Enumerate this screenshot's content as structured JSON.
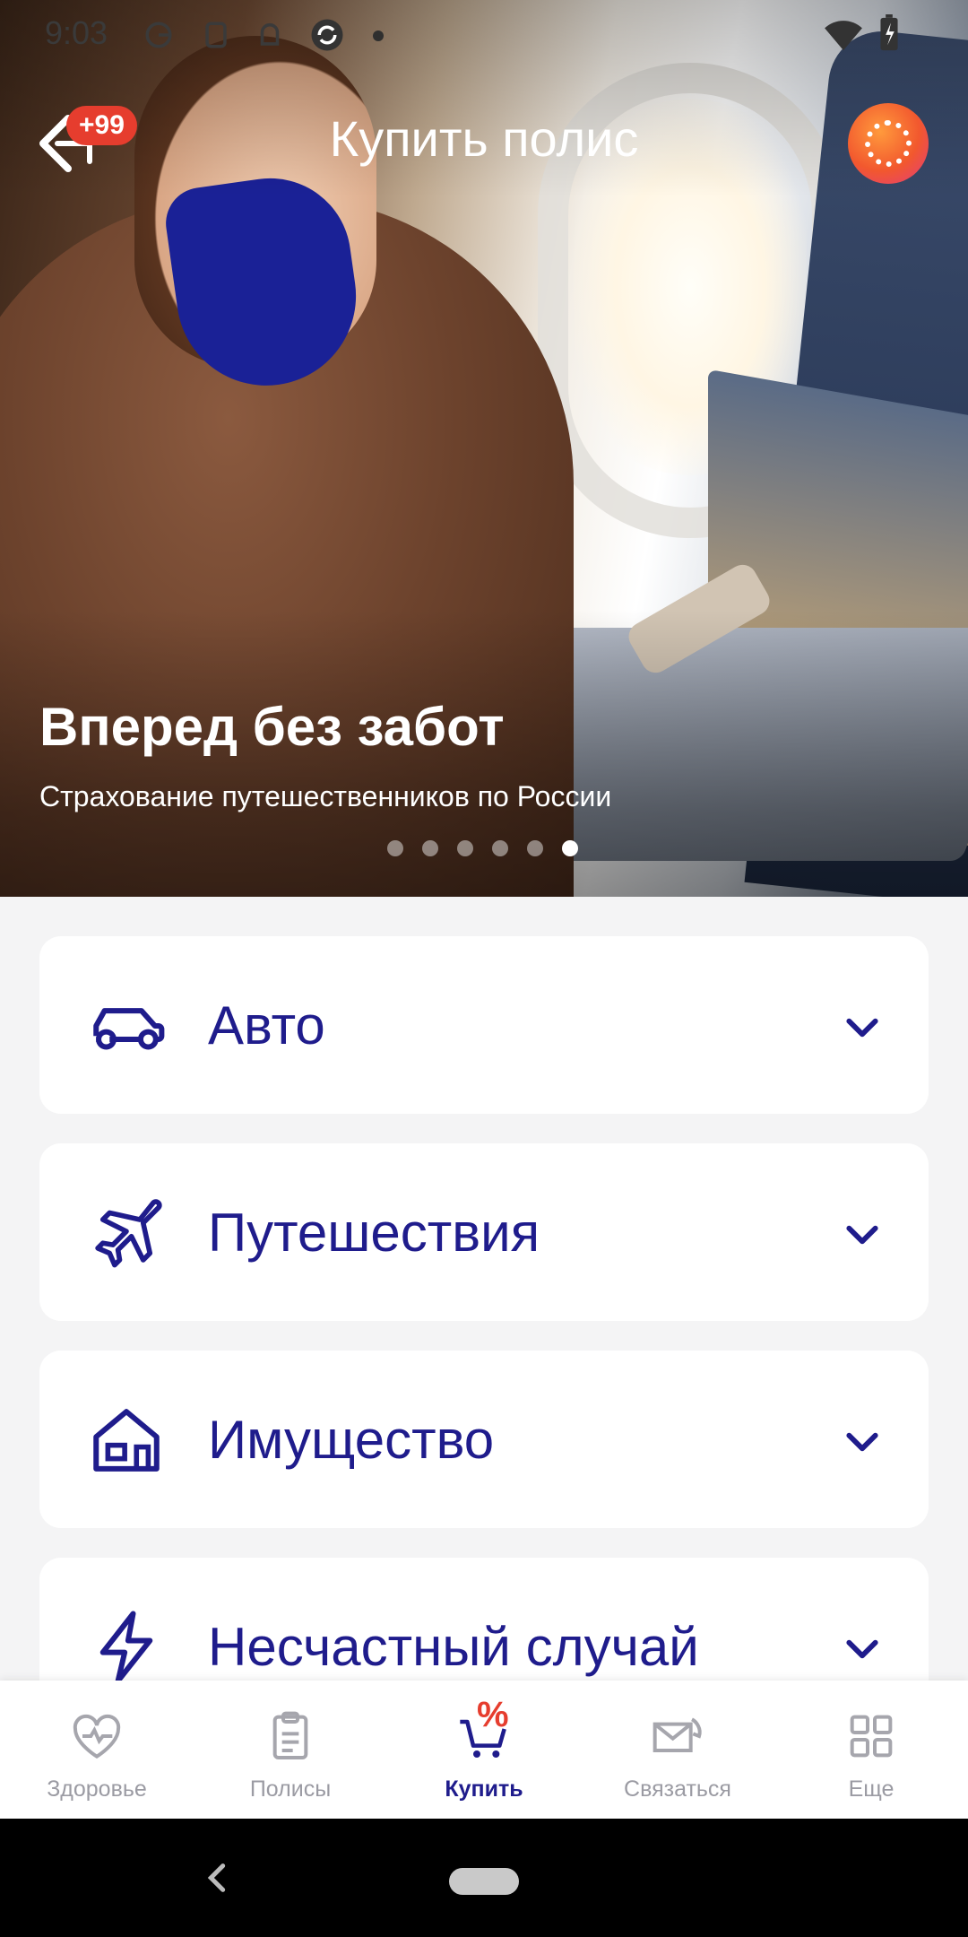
{
  "status_bar": {
    "time": "9:03",
    "icons": [
      "g-icon",
      "s-icon",
      "android-icon",
      "sync-icon",
      "notification-dot-icon",
      "wifi-icon",
      "battery-charging-icon"
    ]
  },
  "header": {
    "title": "Купить полис",
    "back_badge": "+99",
    "back_icon": "megaphone-back-icon",
    "avatar_icon": "profile-avatar-icon"
  },
  "banner": {
    "title": "Вперед без забот",
    "subtitle": "Страхование путешественников по России",
    "slides_total": 6,
    "active_slide": 6
  },
  "categories": [
    {
      "label": "Авто",
      "icon": "car-icon"
    },
    {
      "label": "Путешествия",
      "icon": "airplane-icon"
    },
    {
      "label": "Имущество",
      "icon": "house-icon"
    },
    {
      "label": "Несчастный случай",
      "icon": "lightning-icon"
    }
  ],
  "bottom_nav": {
    "items": [
      {
        "label": "Здоровье",
        "icon": "heart-pulse-icon"
      },
      {
        "label": "Полисы",
        "icon": "clipboard-icon"
      },
      {
        "label": "Купить",
        "icon": "cart-percent-icon"
      },
      {
        "label": "Связаться",
        "icon": "envelope-phone-icon"
      },
      {
        "label": "Еще",
        "icon": "grid-icon"
      }
    ],
    "active_index": 2,
    "badge": "%"
  },
  "colors": {
    "brand": "#1f1c8c",
    "accent": "#e63d2e",
    "inactive": "#a6a6ad",
    "page_bg": "#f4f4f5"
  }
}
